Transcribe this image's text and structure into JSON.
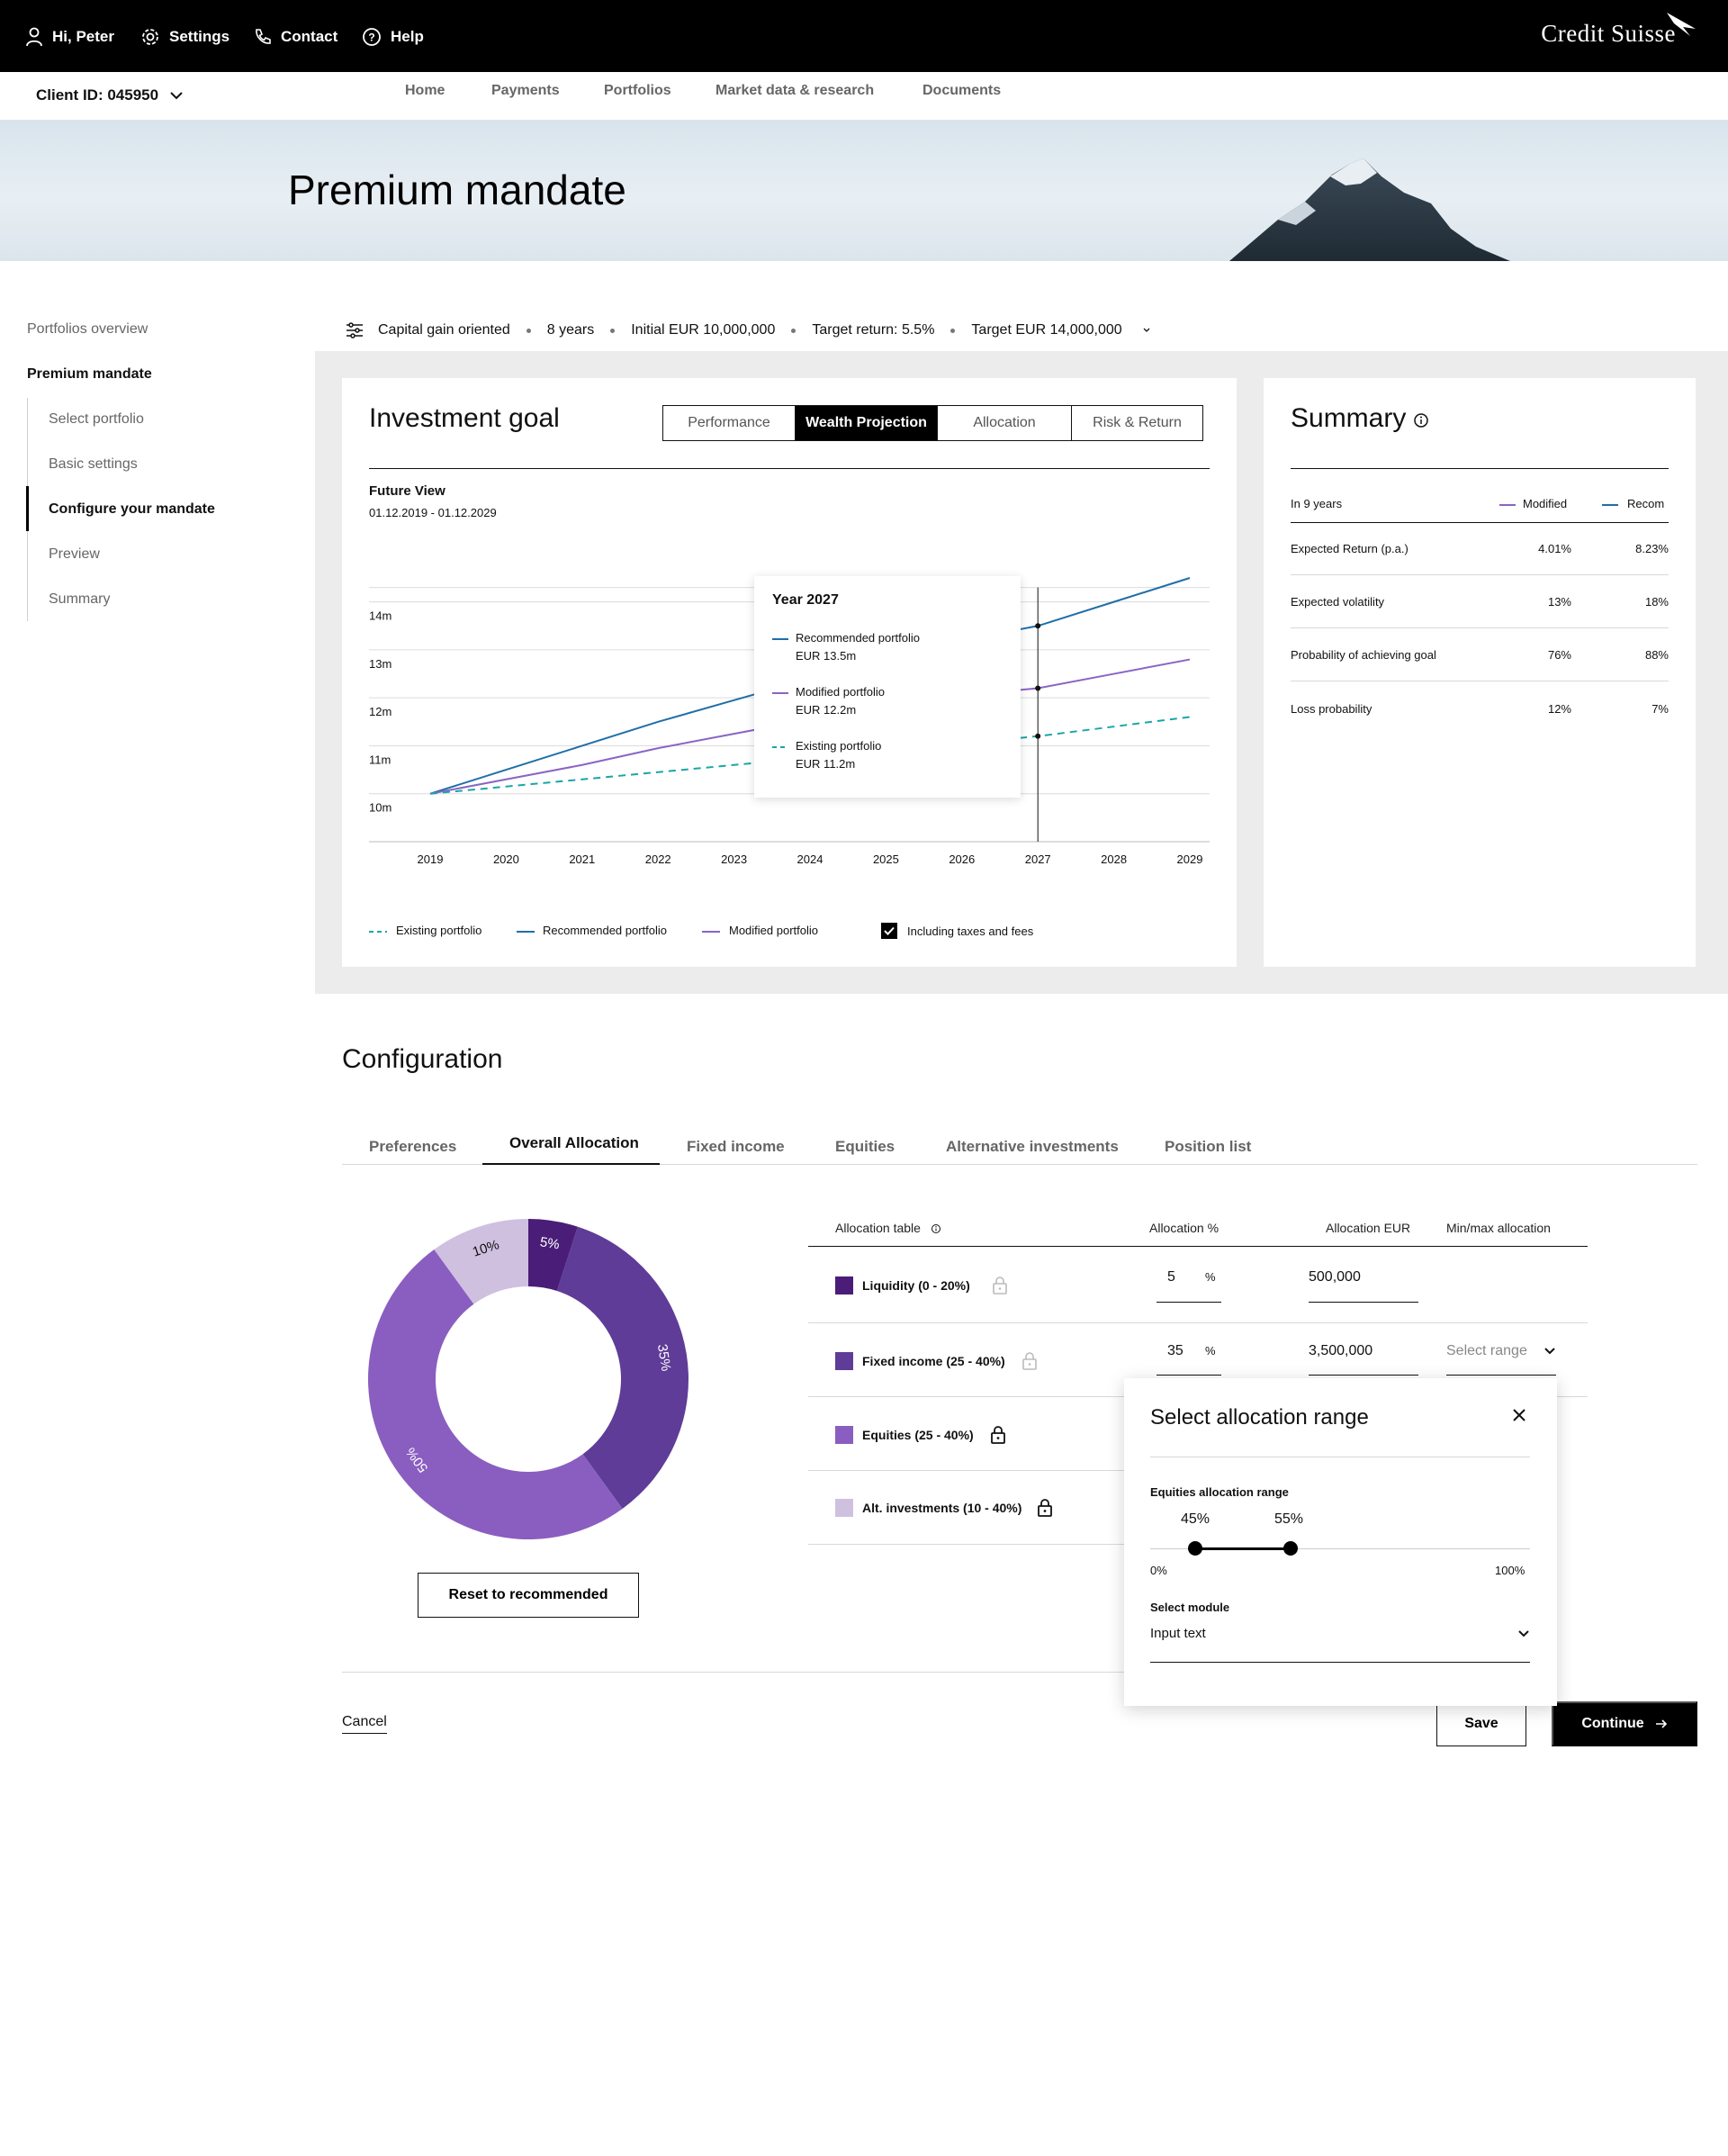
{
  "topbar": {
    "greeting": "Hi, Peter",
    "settings": "Settings",
    "contact": "Contact",
    "help": "Help",
    "brand": "Credit Suisse"
  },
  "subbar": {
    "client_id": "Client ID: 045950",
    "nav": [
      "Home",
      "Payments",
      "Portfolios",
      "Market data & research",
      "Documents"
    ]
  },
  "hero": {
    "title": "Premium mandate"
  },
  "leftnav": {
    "overview": "Portfolios overview",
    "section": "Premium mandate",
    "steps": [
      "Select portfolio",
      "Basic settings",
      "Configure your mandate",
      "Preview",
      "Summary"
    ],
    "active_step": 2
  },
  "filters": {
    "items": [
      "Capital gain oriented",
      "8 years",
      "Initial EUR 10,000,000",
      "Target return: 5.5%",
      "Target EUR 14,000,000"
    ]
  },
  "goal": {
    "title": "Investment goal",
    "tabs": [
      "Performance",
      "Wealth Projection",
      "Allocation",
      "Risk & Return"
    ],
    "active_tab": 1,
    "chart_heading": "Future View",
    "chart_range": "01.12.2019 - 01.12.2029",
    "legend": [
      "Existing portfolio",
      "Recommended portfolio",
      "Modified portfolio"
    ],
    "taxes_label": "Including taxes and fees",
    "taxes_checked": true
  },
  "tooltip": {
    "title": "Year 2027",
    "items": [
      {
        "name": "Recommended portfolio",
        "value": "EUR 13.5m"
      },
      {
        "name": "Modified portfolio",
        "value": "EUR 12.2m"
      },
      {
        "name": "Existing portfolio",
        "value": "EUR 11.2m"
      }
    ]
  },
  "chart_data": {
    "type": "line",
    "title": "Future View",
    "x": [
      2019,
      2020,
      2021,
      2022,
      2023,
      2024,
      2025,
      2026,
      2027,
      2028,
      2029
    ],
    "x_tick_labels": [
      "2019",
      "2020",
      "2021",
      "2022",
      "2023",
      "2024",
      "2025",
      "2026",
      "2027",
      "2028",
      "2029"
    ],
    "y_tick_labels": [
      "10m",
      "11m",
      "12m",
      "13m",
      "14m"
    ],
    "y_ticks": [
      10,
      11,
      12,
      13,
      14
    ],
    "ylim": [
      9,
      14.5
    ],
    "series": [
      {
        "name": "Recommended portfolio",
        "color": "#1f6fa8",
        "dash": false,
        "values": [
          10.0,
          10.5,
          11.0,
          11.5,
          11.95,
          12.4,
          12.85,
          13.2,
          13.5,
          14.0,
          14.5
        ]
      },
      {
        "name": "Modified portfolio",
        "color": "#8a64c4",
        "dash": false,
        "values": [
          10.0,
          10.3,
          10.6,
          10.95,
          11.25,
          11.55,
          11.85,
          12.05,
          12.2,
          12.5,
          12.8
        ]
      },
      {
        "name": "Existing portfolio",
        "color": "#1aa6a6",
        "dash": true,
        "values": [
          10.0,
          10.15,
          10.3,
          10.45,
          10.6,
          10.75,
          10.9,
          11.05,
          11.2,
          11.4,
          11.6
        ]
      }
    ],
    "highlight_x": 2027
  },
  "summary": {
    "title": "Summary",
    "period": "In 9 years",
    "col1": "Modified",
    "col2": "Recom",
    "rows": [
      {
        "label": "Expected Return (p.a.)",
        "v1": "4.01%",
        "v2": "8.23%"
      },
      {
        "label": "Expected volatility",
        "v1": "13%",
        "v2": "18%"
      },
      {
        "label": "Probability of achieving goal",
        "v1": "76%",
        "v2": "88%"
      },
      {
        "label": "Loss probability",
        "v1": "12%",
        "v2": "7%"
      }
    ]
  },
  "config": {
    "title": "Configuration",
    "tabs": [
      "Preferences",
      "Overall Allocation",
      "Fixed income",
      "Equities",
      "Alternative investments",
      "Position list"
    ],
    "active_tab": 1,
    "table_headers": [
      "Allocation table",
      "Allocation %",
      "Allocation EUR",
      "Min/max allocation"
    ],
    "rows": [
      {
        "label": "Liquidity (0 - 20%)",
        "pct": "5",
        "eur": "500,000",
        "color": "#4a1e78"
      },
      {
        "label": "Fixed income (25 - 40%)",
        "pct": "35",
        "eur": "3,500,000",
        "range": "Select range",
        "color": "#5f3c97"
      },
      {
        "label": "Equities (25 - 40%)",
        "color": "#8a5ec0"
      },
      {
        "label": "Alt. investments (10 - 40%)",
        "color": "#cfc0e0"
      }
    ],
    "pct_symbol": "%",
    "reset_label": "Reset to recommended"
  },
  "donut": {
    "slices": [
      {
        "label": "5%",
        "value": 5,
        "color": "#4a1e78"
      },
      {
        "label": "35%",
        "value": 35,
        "color": "#5f3c97"
      },
      {
        "label": "50%",
        "value": 50,
        "color": "#8a5ec0"
      },
      {
        "label": "10%",
        "value": 10,
        "color": "#cfc0e0"
      }
    ]
  },
  "popover": {
    "title": "Select allocation range",
    "range_label": "Equities allocation range",
    "low": "45%",
    "high": "55%",
    "low_value": 45,
    "high_value": 55,
    "min": "0%",
    "max": "100%",
    "module_label": "Select module",
    "module_value": "Input text"
  },
  "footer": {
    "cancel": "Cancel",
    "save": "Save",
    "continue": "Continue"
  }
}
